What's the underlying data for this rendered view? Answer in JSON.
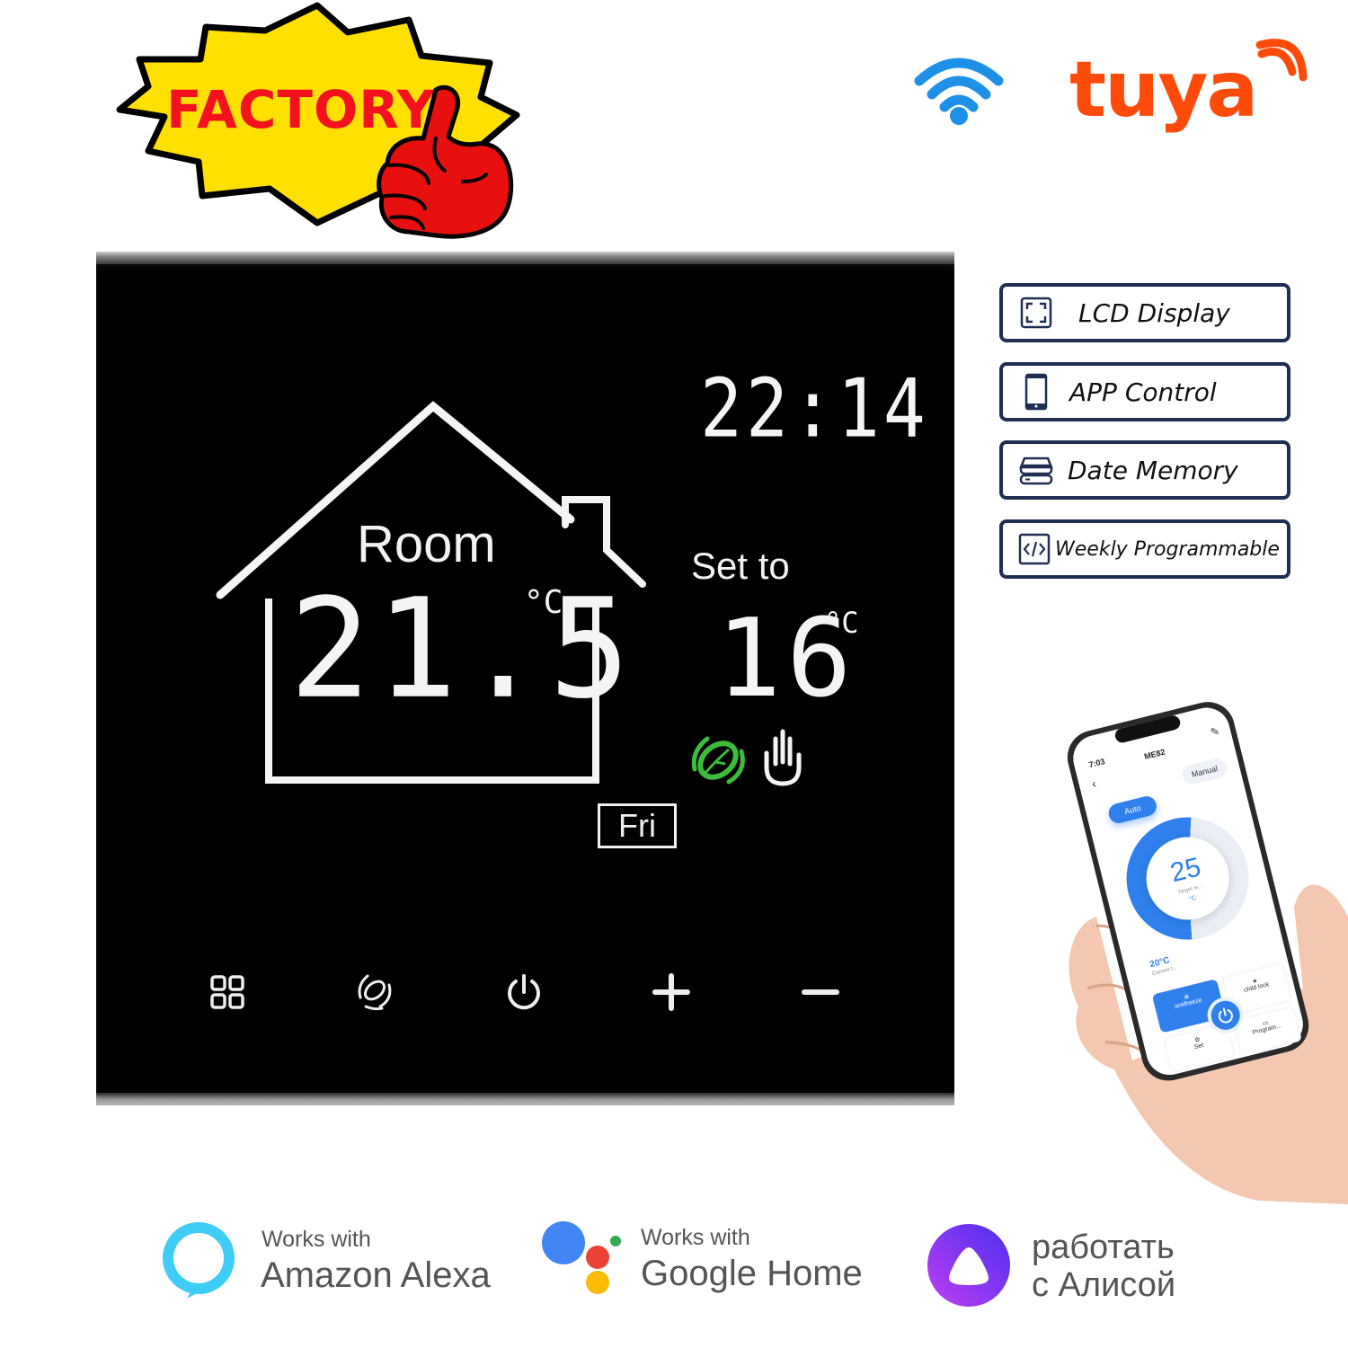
{
  "promo": {
    "badge_text": "FACTORY",
    "badge_colors": {
      "fill": "#ffe000",
      "text": "#f2111d",
      "thumb": "#e8100f"
    }
  },
  "brand": {
    "wifi_icon": "wifi-icon",
    "wifi_color": "#1e90e8",
    "tuya_text": "tuya",
    "tuya_color": "#ff4b0a"
  },
  "thermostat": {
    "clock": "22:14",
    "room_label": "Room",
    "room_temp": "21.5",
    "room_unit": "°C",
    "set_label": "Set to",
    "set_temp": "16",
    "set_unit": "°C",
    "day": "Fri",
    "status_icons": [
      "eco-leaf-icon",
      "manual-hand-icon"
    ],
    "eco_color": "#3dbb3a",
    "buttons": [
      {
        "name": "menu-button",
        "icon": "grid-icon"
      },
      {
        "name": "eco-button",
        "icon": "leaf-icon"
      },
      {
        "name": "power-button",
        "icon": "power-icon"
      },
      {
        "name": "increase-button",
        "icon": "plus-icon"
      },
      {
        "name": "decrease-button",
        "icon": "minus-icon"
      }
    ]
  },
  "features": [
    {
      "label": "LCD Display",
      "icon": "fullscreen-icon"
    },
    {
      "label": "APP Control",
      "icon": "smartphone-icon"
    },
    {
      "label": "Date Memory",
      "icon": "storage-icon"
    },
    {
      "label": "Weekly Programmable",
      "icon": "code-icon"
    }
  ],
  "phone_app": {
    "status_time": "7:03",
    "device_name": "ME82",
    "mode_auto": "Auto",
    "mode_manual": "Manual",
    "target_temp": "25",
    "target_label": "Target te...",
    "target_unit": "°C",
    "current_temp": "20°C",
    "current_label": "Current t...",
    "tiles": [
      "antifreeze",
      "child lock",
      "Set",
      "Program..."
    ],
    "accent": "#2f80ed"
  },
  "compat": {
    "alexa": {
      "works": "Works with",
      "name": "Amazon Alexa",
      "color": "#3fcdf7"
    },
    "google": {
      "works": "Works with",
      "name": "Google Home",
      "colors": [
        "#4285f4",
        "#ea4335",
        "#fbbc05",
        "#34a853"
      ]
    },
    "alice": {
      "line1": "работать",
      "line2": "с Алисой",
      "color": "#8a2be2"
    }
  }
}
